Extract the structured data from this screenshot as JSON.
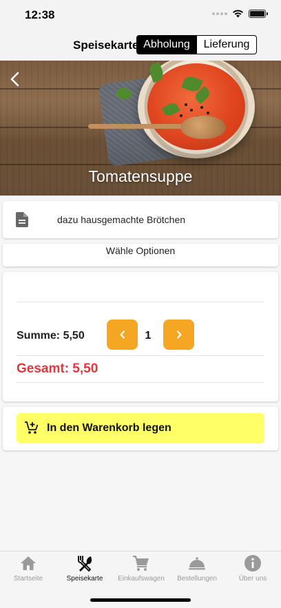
{
  "status_bar": {
    "time": "12:38"
  },
  "header": {
    "title": "Speisekarte",
    "segments": [
      "Abholung",
      "Lieferung"
    ],
    "selected_segment": "Abholung"
  },
  "hero": {
    "title": "Tomatensuppe",
    "back_icon": "chevron-left-icon"
  },
  "description": {
    "icon": "document-icon",
    "text": "dazu hausgemachte Brötchen"
  },
  "options": {
    "label": "Wähle Optionen"
  },
  "summary": {
    "sum_label": "Summe: 5,50",
    "quantity": "1",
    "total_label": "Gesamt: 5,50"
  },
  "cart": {
    "label": "In den Warenkorb legen",
    "icon": "cart-plus-icon"
  },
  "tabs": [
    {
      "label": "Startseite",
      "icon": "home-icon",
      "active": false
    },
    {
      "label": "Speisekarte",
      "icon": "cutlery-icon",
      "active": true
    },
    {
      "label": "Einkaufswagen",
      "icon": "cart-icon",
      "active": false
    },
    {
      "label": "Bestellungen",
      "icon": "cloche-icon",
      "active": false
    },
    {
      "label": "Über uns",
      "icon": "info-icon",
      "active": false
    }
  ],
  "colors": {
    "accent_orange": "#f5a623",
    "total_red": "#e0383e",
    "cart_yellow": "#ffff66"
  }
}
